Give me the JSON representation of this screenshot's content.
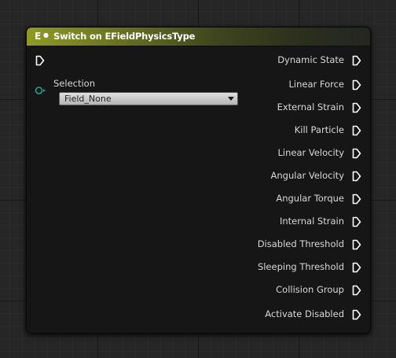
{
  "node": {
    "title": "Switch on EFieldPhysicsType",
    "icon": "switch-enum-icon",
    "header_color": "#909a25",
    "selection": {
      "label": "Selection",
      "value": "Field_None"
    },
    "outputs": [
      {
        "label": "Dynamic State"
      },
      {
        "label": "Linear Force"
      },
      {
        "label": "External Strain"
      },
      {
        "label": "Kill Particle"
      },
      {
        "label": "Linear Velocity"
      },
      {
        "label": "Angular Velocity"
      },
      {
        "label": "Angular Torque"
      },
      {
        "label": "Internal Strain"
      },
      {
        "label": "Disabled Threshold"
      },
      {
        "label": "Sleeping Threshold"
      },
      {
        "label": "Collision Group"
      },
      {
        "label": "Activate Disabled"
      }
    ],
    "selection_pin_color": "#1fa39a",
    "exec_pin_color": "#ffffff"
  }
}
